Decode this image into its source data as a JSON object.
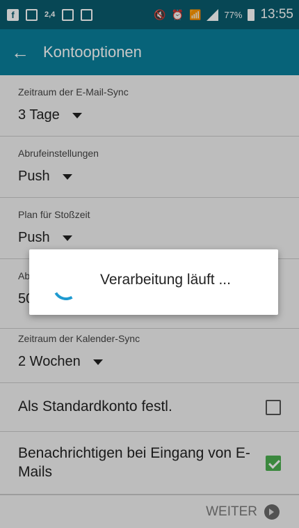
{
  "status_bar": {
    "left_icons": [
      "facebook-icon",
      "image-icon",
      "data-speed-icon",
      "mail-attachment-icon",
      "mail-icon"
    ],
    "data_speed": "2,4",
    "right_icons": [
      "mute-icon",
      "alarm-icon",
      "wifi-icon",
      "signal-icon",
      "battery-icon"
    ],
    "battery": "77%",
    "time": "13:55"
  },
  "app_bar": {
    "title": "Kontooptionen"
  },
  "settings": [
    {
      "label": "Zeitraum der E-Mail-Sync",
      "value": "3 Tage"
    },
    {
      "label": "Abrufeinstellungen",
      "value": "Push"
    },
    {
      "label": "Plan für Stoßzeit",
      "value": "Push"
    },
    {
      "label": "Ab",
      "value": "50"
    },
    {
      "label": "Zeitraum der Kalender-Sync",
      "value": "2 Wochen"
    }
  ],
  "checkboxes": [
    {
      "label": "Als Standardkonto festl.",
      "checked": false
    },
    {
      "label": "Benachrichtigen bei Eingang von E-Mails",
      "checked": true
    }
  ],
  "footer": {
    "next_label": "WEITER"
  },
  "dialog": {
    "message": "Verarbeitung läuft ..."
  },
  "colors": {
    "status_bar": "#0a5c6e",
    "app_bar": "#0a7f9b",
    "spinner": "#1e9ad0",
    "checkbox_checked": "#4caf50"
  }
}
